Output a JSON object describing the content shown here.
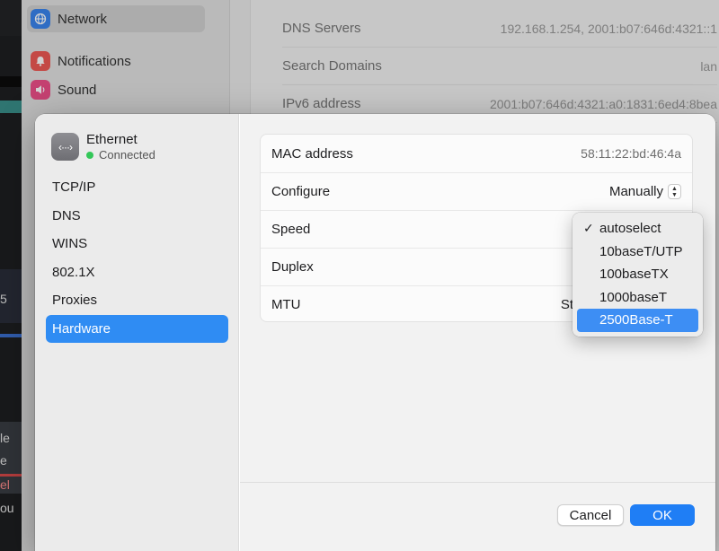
{
  "background": {
    "sidebar_items": [
      {
        "label": "Network",
        "icon": "globe-icon",
        "color": "#3a86f0"
      },
      {
        "label": "Notifications",
        "icon": "bell-icon",
        "color": "#f05a55"
      },
      {
        "label": "Sound",
        "icon": "speaker-icon",
        "color": "#f0508a"
      }
    ],
    "rows": [
      {
        "label": "DNS Servers",
        "value": "192.168.1.254, 2001:b07:646d:4321::1"
      },
      {
        "label": "Search Domains",
        "value": "lan"
      },
      {
        "label": "IPv6 address",
        "value": "2001:b07:646d:4321:a0:1831:6ed4:8bea"
      }
    ],
    "desktop_fragments": [
      "5",
      "le",
      "e",
      "el",
      "ou"
    ]
  },
  "sheet": {
    "interface": {
      "name": "Ethernet",
      "status": "Connected",
      "status_color": "#34c759",
      "icon": "ethernet-icon",
      "icon_glyph": "‹···›"
    },
    "nav": [
      {
        "label": "TCP/IP",
        "active": false
      },
      {
        "label": "DNS",
        "active": false
      },
      {
        "label": "WINS",
        "active": false
      },
      {
        "label": "802.1X",
        "active": false
      },
      {
        "label": "Proxies",
        "active": false
      },
      {
        "label": "Hardware",
        "active": true
      }
    ],
    "hardware": {
      "mac_label": "MAC address",
      "mac_value": "58:11:22:bd:46:4a",
      "configure_label": "Configure",
      "configure_value": "Manually",
      "speed_label": "Speed",
      "duplex_label": "Duplex",
      "mtu_label": "MTU",
      "mtu_value_visible": "St"
    },
    "speed_menu": {
      "options": [
        "autoselect",
        "10baseT/UTP",
        "100baseTX",
        "1000baseT",
        "2500Base-T"
      ],
      "checked": "autoselect",
      "highlighted": "2500Base-T"
    },
    "buttons": {
      "cancel": "Cancel",
      "ok": "OK"
    },
    "accent": "#2f8cf3"
  }
}
